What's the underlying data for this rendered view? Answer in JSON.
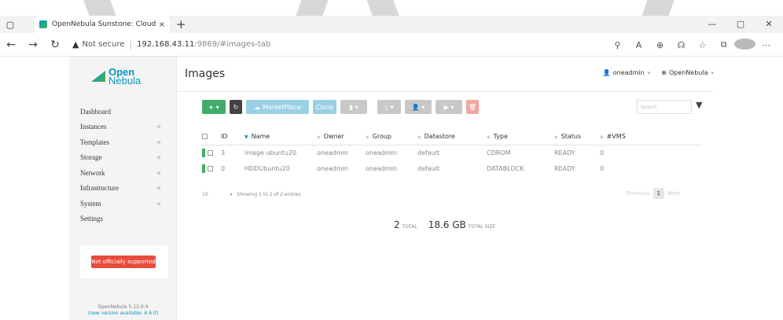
{
  "browser": {
    "tab_title": "OpenNebula Sunstone: Cloud O",
    "tab_close": "×",
    "new_tab": "+",
    "security_label": "Not secure",
    "url_host": "192.168.43.11",
    "url_rest": ":9869/#images-tab"
  },
  "sidebar": {
    "logo_line1": "Open",
    "logo_line2": "Nebula",
    "items": [
      {
        "label": "Dashboard",
        "has_children": false
      },
      {
        "label": "Instances",
        "has_children": true
      },
      {
        "label": "Templates",
        "has_children": true
      },
      {
        "label": "Storage",
        "has_children": true
      },
      {
        "label": "Network",
        "has_children": true
      },
      {
        "label": "Infrastructure",
        "has_children": true
      },
      {
        "label": "System",
        "has_children": true
      },
      {
        "label": "Settings",
        "has_children": false
      }
    ],
    "unsupported_label": "Not officially supported",
    "version": "OpenNebula 5.12.0.4",
    "new_version": "(new version available: 6.6.0)"
  },
  "main": {
    "title": "Images",
    "user": "oneadmin",
    "zone": "OpenNebula",
    "toolbar": {
      "create": "+ ▾",
      "marketplace": "MarketPlace",
      "clone": "Clone"
    },
    "search_placeholder": "Search",
    "table": {
      "headers": [
        "ID",
        "Name",
        "Owner",
        "Group",
        "Datastore",
        "Type",
        "Status",
        "#VMS"
      ],
      "rows": [
        {
          "id": "3",
          "name": "image ubuntu20",
          "owner": "oneadmin",
          "group": "oneadmin",
          "datastore": "default",
          "type": "CDROM",
          "status": "READY",
          "vms": "0"
        },
        {
          "id": "0",
          "name": "HDDUbuntu20",
          "owner": "oneadmin",
          "group": "oneadmin",
          "datastore": "default",
          "type": "DATABLOCK",
          "status": "READY",
          "vms": "0"
        }
      ]
    },
    "footer": {
      "page_length": "10",
      "showing": "Showing 1 to 2 of 2 entries",
      "previous": "Previous",
      "page": "1",
      "next": "Next"
    },
    "totals": {
      "count": "2",
      "count_label": "TOTAL",
      "size": "18.6 GB",
      "size_label": "TOTAL SIZE"
    }
  },
  "colors": {
    "brand": "#0098c3",
    "create_button": "#43ac6a",
    "unsupported_badge": "#e74c3c"
  }
}
